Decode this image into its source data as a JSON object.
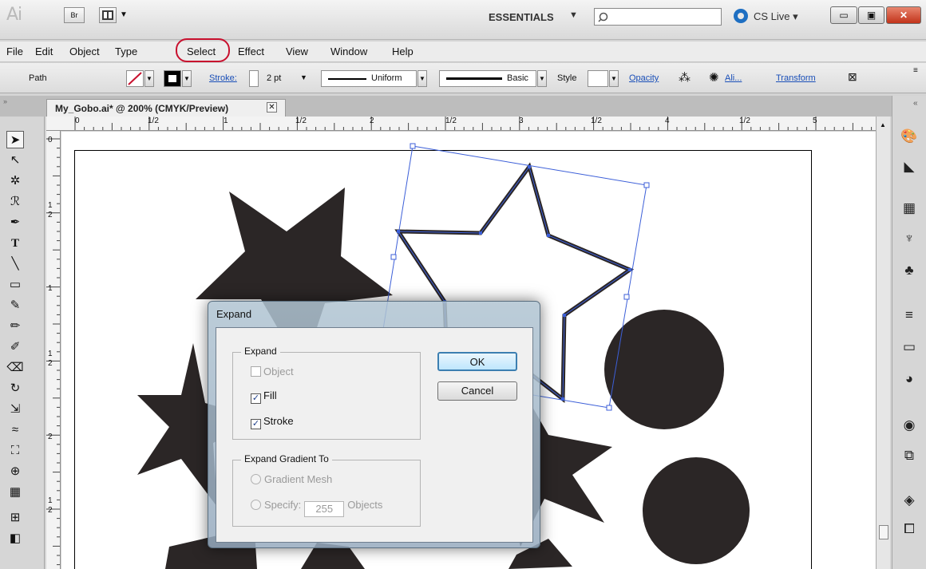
{
  "app": {
    "logo": "Ai",
    "bridge_label": "Br",
    "workspace": "ESSENTIALS",
    "cs_live": "CS Live"
  },
  "menu": {
    "items": [
      "File",
      "Edit",
      "Object",
      "Type",
      "Select",
      "Effect",
      "View",
      "Window",
      "Help"
    ]
  },
  "control_bar": {
    "path_label": "Path",
    "stroke_label": "Stroke:",
    "stroke_weight": "2 pt",
    "profile_label": "Uniform",
    "brush_label": "Basic",
    "style_label": "Style",
    "opacity_label": "Opacity",
    "align_label": "Ali...",
    "transform_label": "Transform"
  },
  "document": {
    "tab_title": "My_Gobo.ai* @ 200% (CMYK/Preview)",
    "close_glyph": "✕"
  },
  "rulers": {
    "top_labels": [
      "0",
      "1/2",
      "1",
      "1/2",
      "2",
      "1/2",
      "3",
      "1/2",
      "4",
      "1/2",
      "5"
    ],
    "left_labels": [
      "0",
      "1",
      "2",
      "1",
      "1",
      "2",
      "2",
      "1",
      "2"
    ]
  },
  "dialog": {
    "title": "Expand",
    "expand_group": {
      "label": "Expand",
      "object_label": "Object",
      "fill_label": "Fill",
      "stroke_label": "Stroke",
      "object_checked": false,
      "fill_checked": true,
      "stroke_checked": true
    },
    "gradient_group": {
      "label": "Expand Gradient To",
      "gradient_mesh_label": "Gradient Mesh",
      "specify_label": "Specify:",
      "specify_value": "255",
      "objects_label": "Objects"
    },
    "ok_label": "OK",
    "cancel_label": "Cancel",
    "check_glyph": "✓"
  },
  "colors": {
    "art_fill": "#2b2626",
    "selection": "#3c5fd8",
    "highlight": "#c8102e"
  }
}
